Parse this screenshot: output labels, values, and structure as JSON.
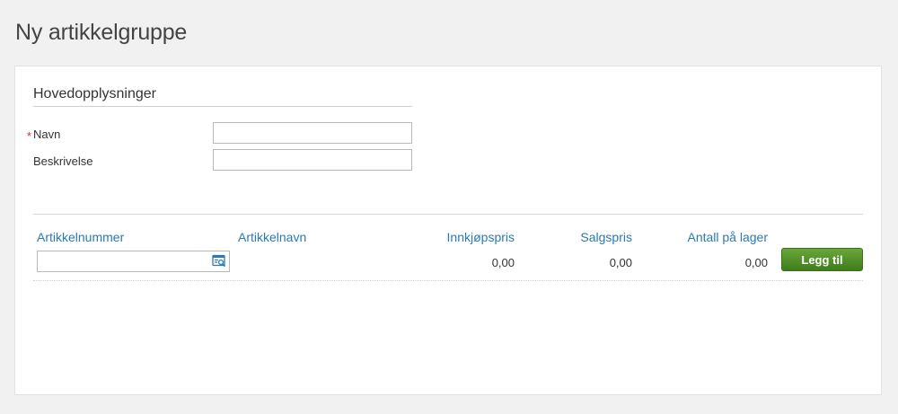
{
  "page": {
    "title": "Ny artikkelgruppe"
  },
  "section": {
    "title": "Hovedopplysninger"
  },
  "form": {
    "required_marker": "*",
    "name_label": "Navn",
    "name_value": "",
    "description_label": "Beskrivelse",
    "description_value": ""
  },
  "items_table": {
    "columns": [
      "Artikkelnummer",
      "Artikkelnavn",
      "Innkjøpspris",
      "Salgspris",
      "Antall på lager"
    ],
    "new_row": {
      "article_number": "",
      "article_name": "",
      "purchase_price": "0,00",
      "sales_price": "0,00",
      "stock_quantity": "0,00"
    },
    "add_label": "Legg til",
    "lookup_icon": "search-list-icon"
  },
  "colors": {
    "link_blue": "#2a7ab0",
    "button_green": "#4f8e26",
    "required_red": "#c0392b"
  }
}
